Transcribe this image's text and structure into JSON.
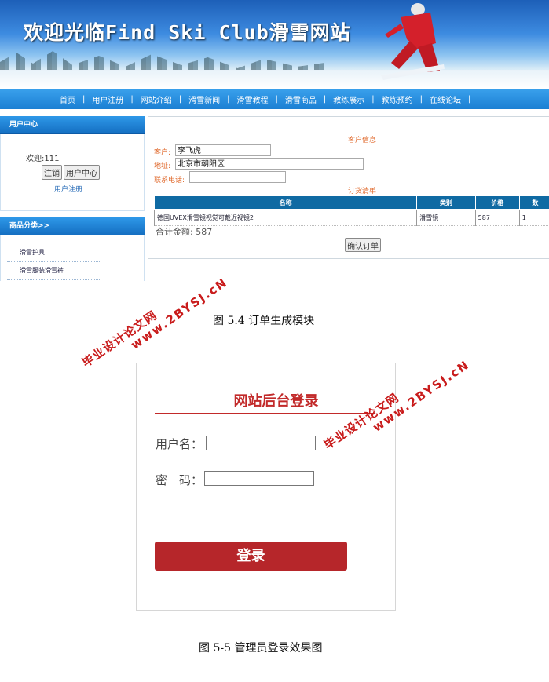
{
  "site": {
    "banner_title": "欢迎光临Find Ski Club滑雪网站",
    "nav": [
      "首页",
      "用户注册",
      "网站介绍",
      "滑雪新闻",
      "滑雪教程",
      "滑雪商品",
      "教练展示",
      "教练预约",
      "在线论坛"
    ],
    "nav_separator": "|",
    "sidebar": {
      "user_center_title": "用户中心",
      "welcome": "欢迎:111",
      "logout_button": "注销",
      "user_center_button": "用户中心",
      "register_link": "用户注册",
      "category_title": "商品分类>>",
      "categories": [
        "滑雪护具",
        "滑雪服装滑雪裤"
      ]
    },
    "order": {
      "customer_info_title": "客户信息",
      "customer_label": "客户:",
      "customer_value": "李飞虎",
      "address_label": "地址:",
      "address_value": "北京市朝阳区",
      "phone_label": "联系电话:",
      "phone_value": "",
      "list_title": "订货清单",
      "columns": [
        "名称",
        "类别",
        "价格",
        "数"
      ],
      "rows": [
        [
          "德国UVEX滑雪镜视觉可戴近视镜2",
          "滑雪镜",
          "587",
          "1"
        ]
      ],
      "total_label": "合计金额:",
      "total_value": "587",
      "confirm_button": "确认订单"
    }
  },
  "caption1": "图 5.4 订单生成模块",
  "caption2": "图 5-5 管理员登录效果图",
  "watermark": {
    "cn": "毕业设计论文网",
    "url": "www.2BYSJ.cN"
  },
  "login": {
    "title": "网站后台登录",
    "username_label": "用户名：",
    "password_label": "密　码：",
    "submit": "登录"
  }
}
